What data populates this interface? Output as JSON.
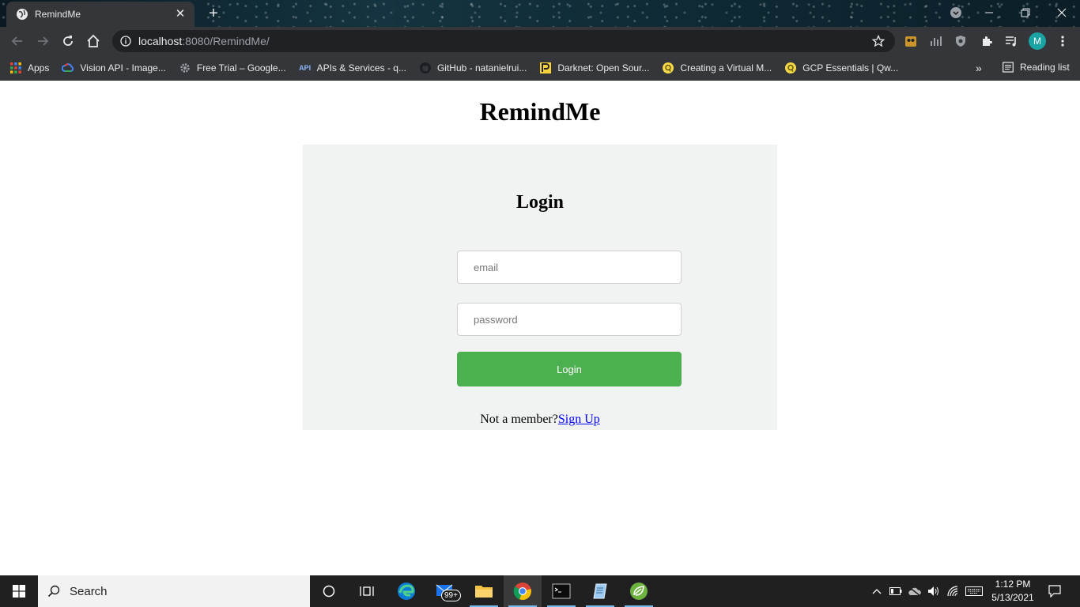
{
  "browser": {
    "tab_title": "RemindMe",
    "new_tab_glyph": "+",
    "url_host": "localhost",
    "url_rest": ":8080/RemindMe/",
    "profile_initial": "M",
    "bookmarks": [
      {
        "label": "Apps",
        "icon": "apps-grid-icon"
      },
      {
        "label": "Vision API - Image...",
        "icon": "google-cloud-icon"
      },
      {
        "label": "Free Trial – Google...",
        "icon": "gear-icon"
      },
      {
        "label": "APIs & Services - q...",
        "icon": "api-icon"
      },
      {
        "label": "GitHub - natanielrui...",
        "icon": "github-icon"
      },
      {
        "label": "Darknet: Open Sour...",
        "icon": "darknet-icon"
      },
      {
        "label": "Creating a Virtual M...",
        "icon": "qwiklabs-icon"
      },
      {
        "label": "GCP Essentials | Qw...",
        "icon": "qwiklabs-icon"
      }
    ],
    "reading_list": "Reading list",
    "more_bookmarks_glyph": "»"
  },
  "page": {
    "app_title": "RemindMe",
    "login_heading": "Login",
    "email_placeholder": "email",
    "password_placeholder": "password",
    "login_button": "Login",
    "not_member_text": "Not a member?",
    "signup_link": "Sign Up"
  },
  "taskbar": {
    "search_text": "Search",
    "mail_badge": "99+",
    "time": "1:12 PM",
    "date": "5/13/2021"
  },
  "colors": {
    "login_button": "#4caf50",
    "card_background": "#f1f2f2",
    "browser_chrome": "#35363a"
  }
}
